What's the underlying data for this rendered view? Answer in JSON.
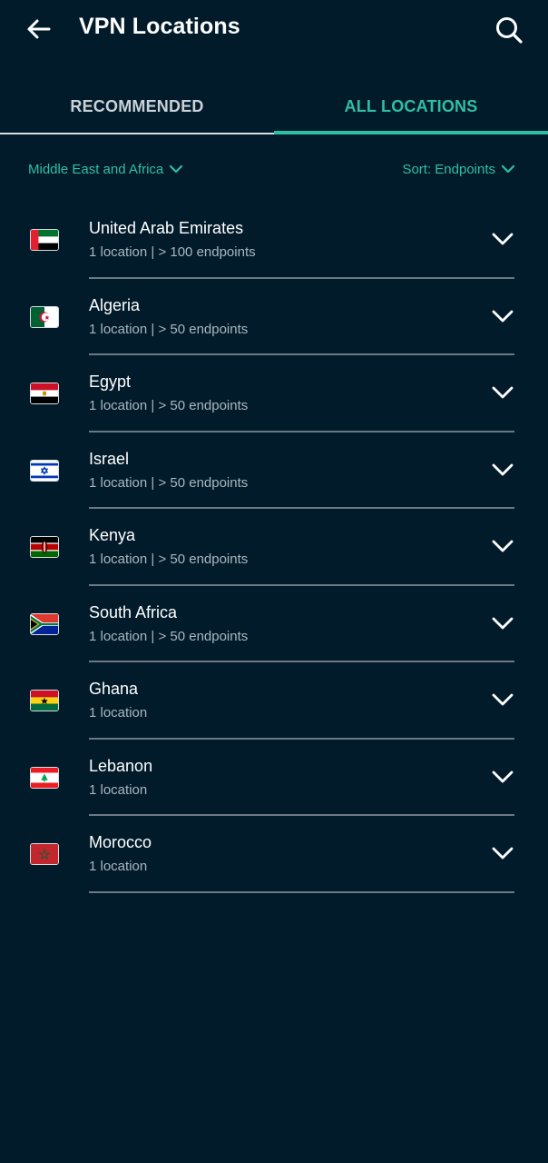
{
  "header": {
    "title": "VPN Locations",
    "back_icon": "arrow-left-icon",
    "search_icon": "search-icon"
  },
  "tabs": [
    {
      "label": "RECOMMENDED",
      "active": false
    },
    {
      "label": "ALL LOCATIONS",
      "active": true
    }
  ],
  "filters": {
    "region": "Middle East and Africa",
    "sort": "Sort: Endpoints"
  },
  "colors": {
    "background": "#021b2b",
    "accent": "#2fbfa4",
    "subtext": "#aab6be"
  },
  "locations": [
    {
      "name": "United Arab Emirates",
      "detail": "1 location | > 100 endpoints",
      "flag": "uae-flag-icon"
    },
    {
      "name": "Algeria",
      "detail": "1 location | > 50 endpoints",
      "flag": "algeria-flag-icon"
    },
    {
      "name": "Egypt",
      "detail": "1 location | > 50 endpoints",
      "flag": "egypt-flag-icon"
    },
    {
      "name": "Israel",
      "detail": "1 location | > 50 endpoints",
      "flag": "israel-flag-icon"
    },
    {
      "name": "Kenya",
      "detail": "1 location | > 50 endpoints",
      "flag": "kenya-flag-icon"
    },
    {
      "name": "South Africa",
      "detail": "1 location | > 50 endpoints",
      "flag": "south-africa-flag-icon"
    },
    {
      "name": "Ghana",
      "detail": "1 location",
      "flag": "ghana-flag-icon"
    },
    {
      "name": "Lebanon",
      "detail": "1 location",
      "flag": "lebanon-flag-icon"
    },
    {
      "name": "Morocco",
      "detail": "1 location",
      "flag": "morocco-flag-icon"
    }
  ]
}
